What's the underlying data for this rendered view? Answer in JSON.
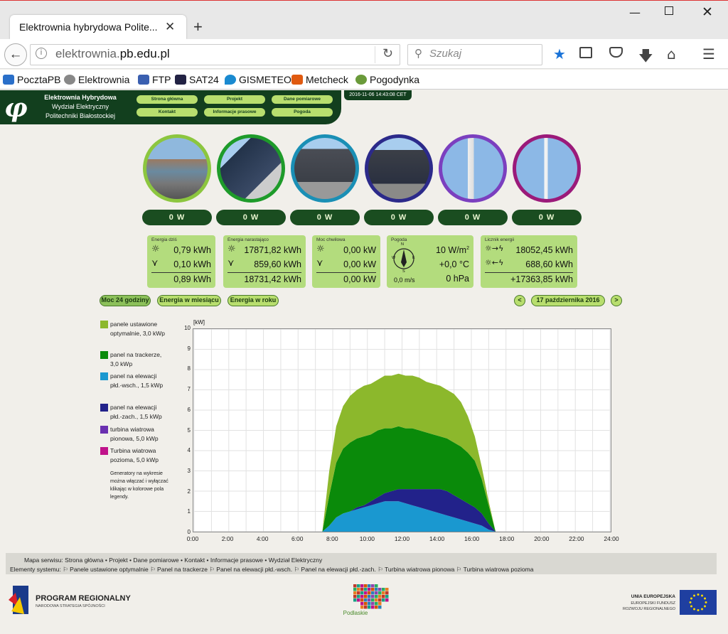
{
  "browser": {
    "tab_title": "Elektrownia hybrydowa Polite...",
    "tab_close": "✕",
    "new_tab": "+",
    "url_prefix": "elektrownia.",
    "url_domain": "pb.edu.pl",
    "search_placeholder": "Szukaj",
    "bookmarks": [
      "PocztaPB",
      "Elektrownia",
      "FTP",
      "SAT24",
      "GISMETEO",
      "Metcheck",
      "Pogodynka"
    ]
  },
  "site": {
    "logo": "φ",
    "title_line1": "Elektrownia Hybrydowa",
    "title_line2": "Wydział Elektryczny",
    "title_line3": "Politechniki Białostockiej",
    "nav": [
      "Strona główna",
      "Projekt",
      "Dane pomiarowe",
      "Kontakt",
      "Informacje prasowe",
      "Pogoda"
    ],
    "datetime": "2016-11-06 14:43:08 CET"
  },
  "generators": {
    "powers": [
      "0 W",
      "0 W",
      "0 W",
      "0 W",
      "0 W",
      "0 W"
    ],
    "ring_colors": [
      "#8cc63f",
      "#1e9b2a",
      "#1a8fb5",
      "#2c2a8a",
      "#7b3fbf",
      "#9b1a7a"
    ]
  },
  "panels": {
    "daily": {
      "label": "Energia dziś",
      "row1": "0,79 kWh",
      "row2": "0,10 kWh",
      "total": "0,89 kWh"
    },
    "cumulative": {
      "label": "Energia narastająco",
      "row1": "17871,82 kWh",
      "row2": "859,60 kWh",
      "total": "18731,42 kWh"
    },
    "instant": {
      "label": "Moc chwilowa",
      "row1": "0,00 kW",
      "row2": "0,00 kW",
      "total": "0,00 kW"
    },
    "weather": {
      "label": "Pogoda",
      "irradiance": "10 W/m",
      "irradiance_sup": "2",
      "temp": "+0,0 °C",
      "pressure": "0 hPa",
      "wind": "0,0 m/s",
      "compass_n": "N",
      "compass_s": "S",
      "compass_w": "W",
      "compass_e": "E"
    },
    "meter": {
      "label": "Licznik energii",
      "row1": "18052,45 kWh",
      "row2": "688,60 kWh",
      "total": "+17363,85 kWh"
    }
  },
  "tabs": [
    "Moc 24 godziny",
    "Energia w miesiącu",
    "Energia w roku"
  ],
  "date_nav": {
    "prev": "<",
    "date": "17 października 2016",
    "next": ">"
  },
  "legend": [
    {
      "label": "panele ustawione optymalnie, 3,0 kWp",
      "color": "#8cb82c"
    },
    {
      "label": "panel na trackerze, 3,0 kWp",
      "color": "#0a8a0a"
    },
    {
      "label": "panel na elewacji płd.-wsch., 1,5 kWp",
      "color": "#1a98d0"
    },
    {
      "label": "panel na elewacji płd.-zach., 1,5 kWp",
      "color": "#22228a"
    },
    {
      "label": "turbina wiatrowa pionowa, 5,0 kWp",
      "color": "#6a30b0"
    },
    {
      "label": "Turbina wiatrowa pozioma, 5,0 kWp",
      "color": "#c0128a"
    }
  ],
  "legend_note": "Generatory na wykresie można włączać i wyłączać klikając w kolorowe pola legendy.",
  "chart_data": {
    "type": "area",
    "ylabel": "[kW]",
    "ylim": [
      0,
      10
    ],
    "yticks": [
      "0",
      "1",
      "2",
      "3",
      "4",
      "5",
      "6",
      "7",
      "8",
      "9",
      "10"
    ],
    "xticks": [
      "0:00",
      "2:00",
      "4:00",
      "6:00",
      "8:00",
      "10:00",
      "12:00",
      "14:00",
      "16:00",
      "18:00",
      "20:00",
      "22:00",
      "24:00"
    ],
    "xlim": [
      0,
      24
    ],
    "grid": true,
    "stacked": true,
    "x_hours": [
      7.4,
      7.8,
      8.2,
      8.6,
      9.0,
      9.4,
      9.8,
      10.2,
      10.6,
      11.0,
      11.4,
      11.8,
      12.2,
      12.6,
      13.0,
      13.4,
      13.8,
      14.2,
      14.6,
      15.0,
      15.4,
      15.8,
      16.2,
      16.6,
      17.0,
      17.4
    ],
    "series": [
      {
        "name": "panel na elewacji płd.-wsch., 1,5 kWp",
        "values": [
          0.0,
          0.3,
          0.7,
          0.9,
          1.0,
          1.1,
          1.2,
          1.3,
          1.4,
          1.5,
          1.5,
          1.5,
          1.4,
          1.3,
          1.2,
          1.1,
          1.0,
          0.9,
          0.8,
          0.7,
          0.6,
          0.5,
          0.4,
          0.3,
          0.1,
          0.0
        ]
      },
      {
        "name": "panel na elewacji płd.-zach., 1,5 kWp",
        "values": [
          0.0,
          0.0,
          0.0,
          0.0,
          0.0,
          0.1,
          0.1,
          0.2,
          0.3,
          0.4,
          0.5,
          0.6,
          0.7,
          0.8,
          0.9,
          1.0,
          1.1,
          1.2,
          1.2,
          1.1,
          1.0,
          0.9,
          0.8,
          0.6,
          0.3,
          0.0
        ]
      },
      {
        "name": "panel na trackerze, 3,0 kWp",
        "values": [
          0.0,
          1.5,
          2.7,
          3.2,
          3.4,
          3.4,
          3.4,
          3.3,
          3.3,
          3.2,
          3.1,
          3.1,
          3.0,
          3.0,
          2.9,
          2.8,
          2.7,
          2.6,
          2.6,
          2.6,
          2.6,
          2.5,
          2.3,
          1.7,
          0.9,
          0.0
        ]
      },
      {
        "name": "panele ustawione optymalnie, 3,0 kWp",
        "values": [
          0.0,
          1.2,
          1.8,
          2.1,
          2.3,
          2.4,
          2.5,
          2.5,
          2.5,
          2.6,
          2.6,
          2.6,
          2.6,
          2.6,
          2.6,
          2.5,
          2.5,
          2.5,
          2.4,
          2.4,
          2.2,
          1.8,
          1.2,
          0.6,
          0.2,
          0.0
        ]
      }
    ]
  },
  "footer": {
    "line1": "Mapa serwisu:  Strona główna • Projekt • Dane pomiarowe • Kontakt • Informacje prasowe • Wydział Elektryczny",
    "line2": "Elementy systemu:  ⚐ Panele ustawione optymalnie  ⚐ Panel na trackerze  ⚐ Panel na elewacji płd.-wsch.  ⚐ Panel na elewacji płd.-zach.  ⚐ Turbina wiatrowa pionowa  ⚐ Turbina wiatrowa pozioma"
  },
  "logos": {
    "program_title": "PROGRAM REGIONALNY",
    "program_sub": "NARODOWA STRATEGIA SPÓJNOŚCI",
    "podlaskie": "Podlaskie",
    "eu_line1": "UNIA EUROPEJSKA",
    "eu_line2": "EUROPEJSKI FUNDUSZ",
    "eu_line3": "ROZWOJU REGIONALNEGO"
  }
}
